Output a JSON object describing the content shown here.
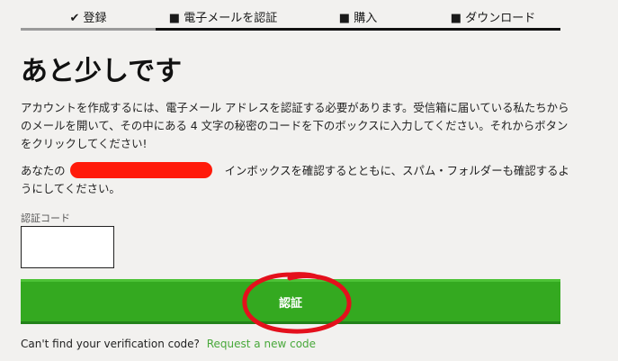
{
  "steps": [
    {
      "label": "✔ 登録",
      "state": "done"
    },
    {
      "label": "■ 電子メールを認証",
      "state": "current"
    },
    {
      "label": "■ 購入",
      "state": "pending"
    },
    {
      "label": "■ ダウンロード",
      "state": "pending"
    }
  ],
  "title": "あと少しです",
  "instructions": "アカウントを作成するには、電子メール アドレスを認証する必要があります。受信箱に届いている私たちからのメールを開いて、その中にある 4 文字の秘密のコードを下のボックスに入力してください。それからボタンをクリックしてください!",
  "inbox_notice": {
    "prefix": "あなたの",
    "suffix": "インボックスを確認するとともに、スパム・フォルダーも確認するようにしてください。"
  },
  "code_field": {
    "label": "認証コード",
    "value": "",
    "placeholder": ""
  },
  "verify_button": {
    "label": "認証"
  },
  "footer": {
    "question": "Can't find your verification code?",
    "link": "Request a new code"
  },
  "colors": {
    "background": "#f2f1ef",
    "button": "#34a920",
    "link": "#48a83a",
    "annotation": "#e4101c",
    "redaction": "#ff1a0a"
  }
}
